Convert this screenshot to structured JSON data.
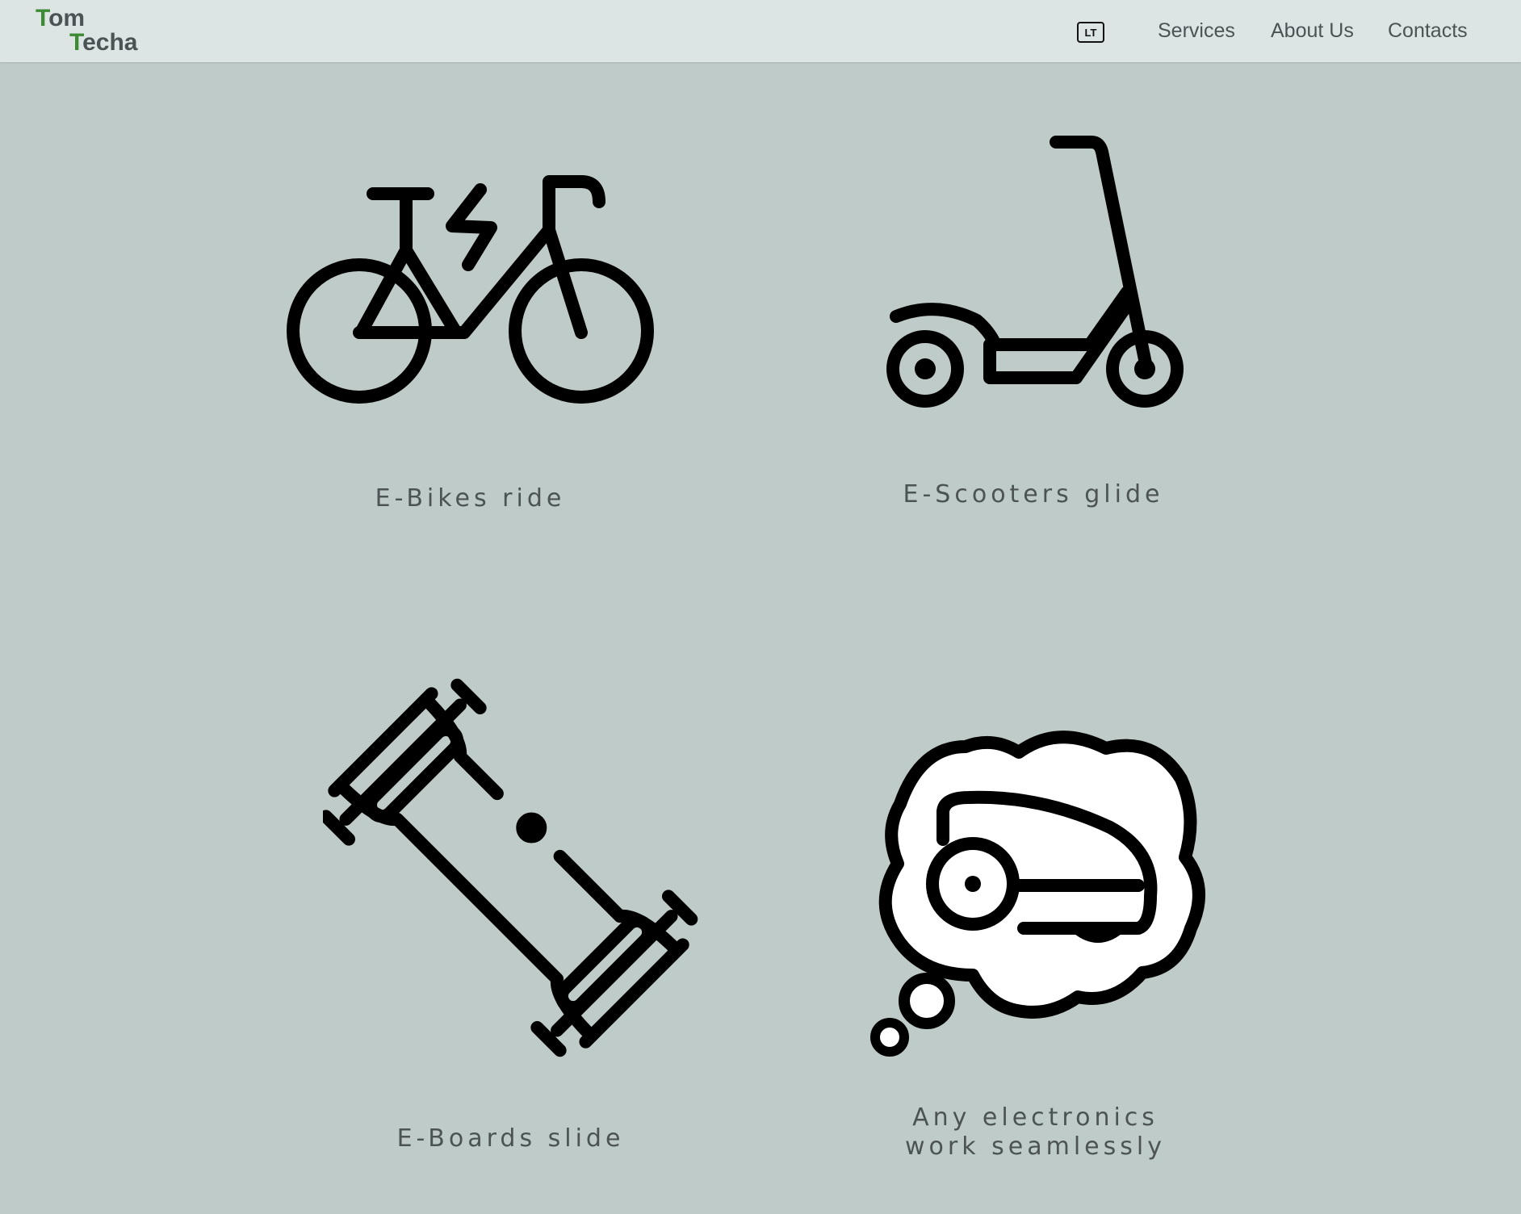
{
  "header": {
    "logo": {
      "line1_first": "T",
      "line1_rest": "om",
      "line2_first": "T",
      "line2_rest": "echa"
    },
    "language_toggle": "LT",
    "nav": [
      "Services",
      "About Us",
      "Contacts"
    ]
  },
  "cards": [
    {
      "icon": "electric-bike-icon",
      "caption": "E-Bikes ride"
    },
    {
      "icon": "electric-scooter-icon",
      "caption": "E-Scooters glide"
    },
    {
      "icon": "electric-skateboard-icon",
      "caption": "E-Boards slide"
    },
    {
      "icon": "robot-mower-thought-icon",
      "caption_line1": "Any electronics",
      "caption_line2": "work seamlessly"
    }
  ],
  "colors": {
    "background": "#bfcbc8",
    "header": "#dde4e4",
    "logo_accent": "#3d8a35",
    "text": "#4c5354"
  }
}
